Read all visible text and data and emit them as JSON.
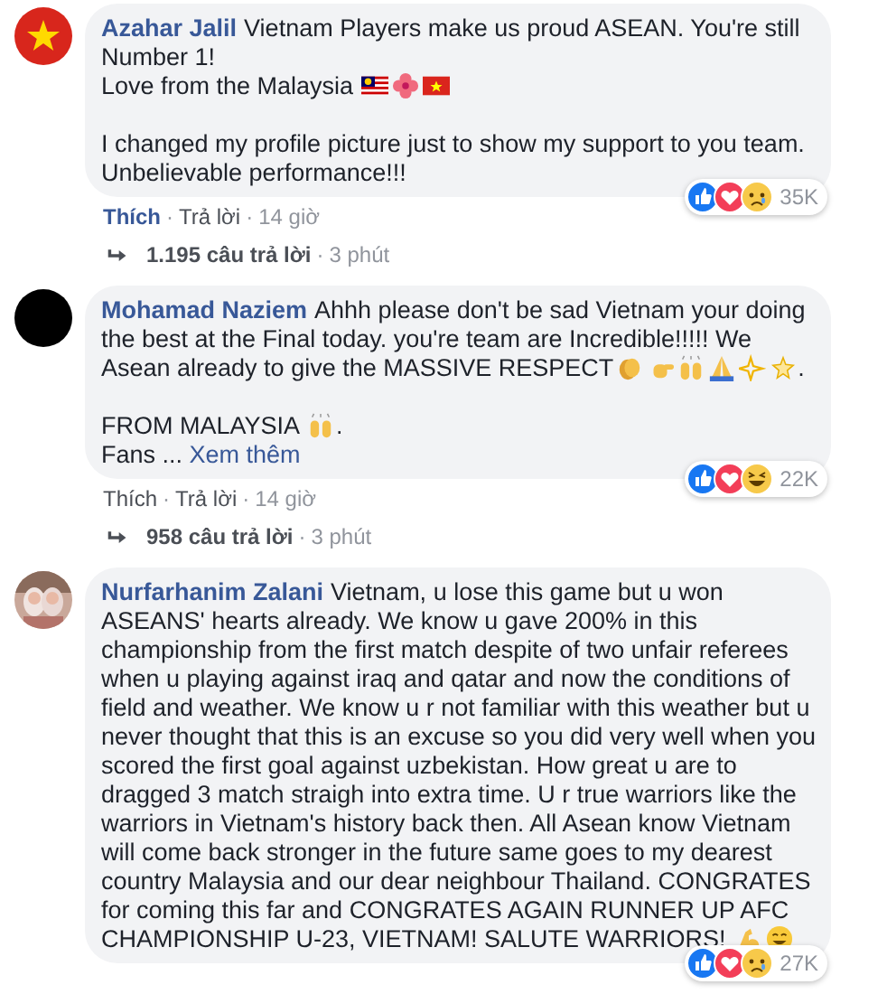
{
  "comments": [
    {
      "author": "Azahar Jalil",
      "avatar": {
        "kind": "vnflag"
      },
      "paragraphs": [
        [
          [
            {
              "kind": "text",
              "text": "Vietnam Players make us proud ASEAN. You're still Number 1!"
            }
          ],
          [
            {
              "kind": "text",
              "text": "Love from the Malaysia "
            },
            {
              "kind": "myflag"
            },
            {
              "kind": "hibiscus"
            },
            {
              "kind": "vnflag"
            }
          ]
        ],
        [
          [
            {
              "kind": "text",
              "text": "I changed my profile picture just to show my support to you team. Unbelievable performance!!!"
            }
          ]
        ]
      ],
      "reactions": [
        {
          "kind": "like"
        },
        {
          "kind": "love"
        },
        {
          "kind": "sad"
        }
      ],
      "reaction_count": "35K",
      "actions": {
        "like": "Thích",
        "liked": true,
        "separator_1": "·",
        "reply": "Trả lời",
        "separator_2": "·",
        "time": "14 giờ"
      },
      "replies": {
        "count": "1.195 câu trả lời",
        "separator": "·",
        "time": "3 phút"
      }
    },
    {
      "author": "Mohamad Naziem",
      "avatar": {
        "kind": "dark"
      },
      "paragraphs": [
        [
          [
            {
              "kind": "text",
              "text": "Ahhh please don't be sad Vietnam your doing the best at the Final today. you're team are Incredible!!!!! We Asean already to give the MASSIVE RESPECT"
            },
            {
              "kind": "clap"
            },
            {
              "kind": "thumb"
            },
            {
              "kind": "raisedhands"
            },
            {
              "kind": "pray"
            },
            {
              "kind": "sparkles"
            },
            {
              "kind": "dizzy"
            },
            {
              "kind": "text",
              "text": "."
            }
          ]
        ],
        [
          [
            {
              "kind": "text",
              "text": "FROM MALAYSIA "
            },
            {
              "kind": "raisedhands"
            },
            {
              "kind": "text",
              "text": "."
            }
          ],
          [
            {
              "kind": "text",
              "text": "Fans ... "
            },
            {
              "kind": "link",
              "text": "Xem thêm"
            }
          ]
        ]
      ],
      "reactions": [
        {
          "kind": "like"
        },
        {
          "kind": "love"
        },
        {
          "kind": "haha"
        }
      ],
      "reaction_count": "22K",
      "actions": {
        "like": "Thích",
        "liked": false,
        "separator_1": "·",
        "reply": "Trả lời",
        "separator_2": "·",
        "time": "14 giờ"
      },
      "replies": {
        "count": "958 câu trả lời",
        "separator": "·",
        "time": "3 phút"
      }
    },
    {
      "author": "Nurfarhanim Zalani",
      "avatar": {
        "kind": "picture"
      },
      "paragraphs": [
        [
          [
            {
              "kind": "text",
              "text": "Vietnam, u lose this game but u won ASEANS' hearts already. We know u gave 200% in this championship from the first match despite of two unfair referees when u playing against iraq and qatar and now the conditions of field and weather. We know u r not familiar with this weather but u never thought that this is an excuse so you did very well when you scored the first goal against uzbekistan. How great u are to dragged 3 match straigh into extra time. U r true warriors like the warriors in Vietnam's history back then. All Asean know Vietnam will come back stronger in the future same goes to my dearest country Malaysia and our dear neighbour Thailand. CONGRATES for coming this far and CONGRATES AGAIN RUNNER UP AFC CHAMPIONSHIP U-23, VIETNAM! SALUTE WARRIORS! "
            },
            {
              "kind": "muscle"
            },
            {
              "kind": "smile"
            }
          ]
        ]
      ],
      "reactions": [
        {
          "kind": "like"
        },
        {
          "kind": "love"
        },
        {
          "kind": "sad"
        }
      ],
      "reaction_count": "27K"
    }
  ]
}
